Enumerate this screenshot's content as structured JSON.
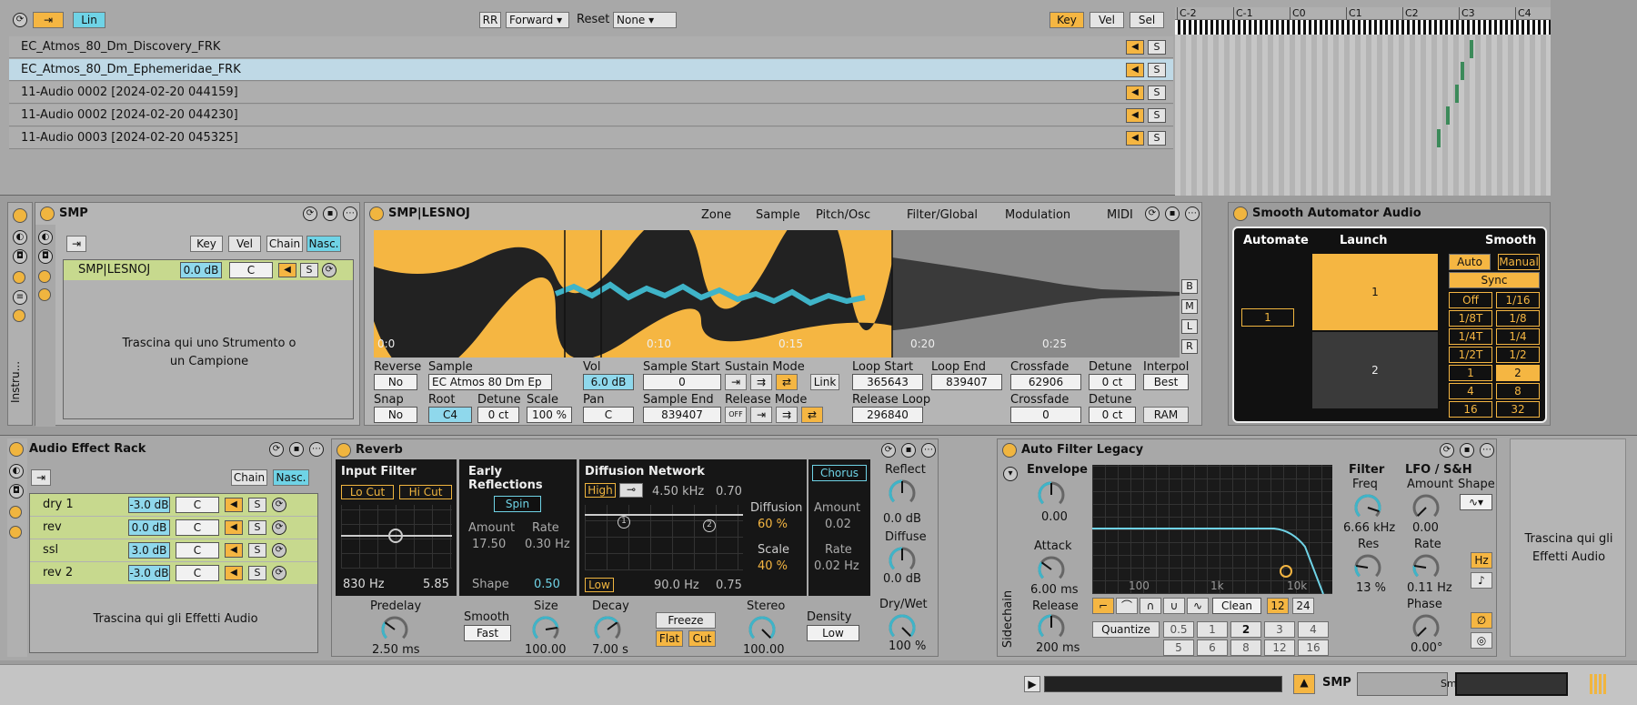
{
  "topbar": {
    "lin": "Lin",
    "rr": "RR",
    "forward": "Forward",
    "reset": "Reset",
    "reset_val": "None",
    "key": "Key",
    "vel": "Vel",
    "sel": "Sel"
  },
  "keyboard": {
    "notes": [
      "C-2",
      "C-1",
      "C0",
      "C1",
      "C2",
      "C3",
      "C4"
    ]
  },
  "samples": [
    {
      "name": "EC_Atmos_80_Dm_Discovery_FRK"
    },
    {
      "name": "EC_Atmos_80_Dm_Ephemeridae_FRK"
    },
    {
      "name": "11-Audio 0002 [2024-02-20 044159]"
    },
    {
      "name": "11-Audio 0002 [2024-02-20 044230]"
    },
    {
      "name": "11-Audio 0003 [2024-02-20 045325]"
    }
  ],
  "solo_label": "S",
  "side": {
    "label": "Instru..."
  },
  "smp_rack": {
    "title": "SMP",
    "key": "Key",
    "vel": "Vel",
    "chain": "Chain",
    "nasc": "Nasc.",
    "chain_name": "SMP|LESNOJ",
    "vol": "0.0 dB",
    "pan": "C",
    "drop": "Trascina qui uno Strumento o un Campione"
  },
  "sampler": {
    "title": "SMP|LESNOJ",
    "tabs": [
      "Zone",
      "Sample",
      "Pitch/Osc",
      "Filter/Global",
      "Modulation",
      "MIDI"
    ],
    "time_labels": [
      "0:0",
      "0:10",
      "0:15",
      "0:20",
      "0:25"
    ],
    "side_btns": [
      "B",
      "M",
      "L",
      "R"
    ],
    "reverse_l": "Reverse",
    "reverse": "No",
    "sample_l": "Sample",
    "sample": "EC Atmos 80 Dm Ep",
    "vol_l": "Vol",
    "vol": "6.0 dB",
    "sstart_l": "Sample Start",
    "sstart": "0",
    "sus_l": "Sustain Mode",
    "link": "Link",
    "lstart_l": "Loop Start",
    "lstart": "365643",
    "lend_l": "Loop End",
    "lend": "839407",
    "xfade_l": "Crossfade",
    "xfade": "62906",
    "det_l": "Detune",
    "det": "0 ct",
    "interp_l": "Interpol",
    "interp": "Best",
    "snap_l": "Snap",
    "snap": "No",
    "root_l": "Root",
    "root": "C4",
    "det2_l": "Detune",
    "det2": "0 ct",
    "scale_l": "Scale",
    "scale": "100 %",
    "pan_l": "Pan",
    "pan": "C",
    "send_l": "Sample End",
    "send": "839407",
    "rel_l": "Release Mode",
    "off": "OFF",
    "rloop_l": "Release Loop",
    "rloop": "296840",
    "xfade2_l": "Crossfade",
    "xfade2": "0",
    "det3_l": "Detune",
    "det3": "0 ct",
    "ram": "RAM"
  },
  "automator": {
    "title": "Smooth Automator Audio",
    "automate": "Automate",
    "launch": "Launch",
    "smooth": "Smooth",
    "auto": "Auto",
    "manual": "Manual",
    "sync": "Sync",
    "value": "1",
    "slot1": "1",
    "slot2": "2",
    "grid": [
      "Off",
      "1/16",
      "1/8T",
      "1/8",
      "1/4T",
      "1/4",
      "1/2T",
      "1/2",
      "1",
      "2",
      "4",
      "8",
      "16",
      "32"
    ]
  },
  "fx_rack": {
    "title": "Audio Effect Rack",
    "chain": "Chain",
    "nasc": "Nasc.",
    "chains": [
      {
        "name": "dry 1",
        "vol": "-3.0 dB",
        "pan": "C"
      },
      {
        "name": "rev",
        "vol": "0.0 dB",
        "pan": "C"
      },
      {
        "name": "ssl",
        "vol": "3.0 dB",
        "pan": "C"
      },
      {
        "name": "rev 2",
        "vol": "-3.0 dB",
        "pan": "C"
      }
    ],
    "drop": "Trascina qui gli Effetti Audio"
  },
  "reverb": {
    "title": "Reverb",
    "input": "Input Filter",
    "locut": "Lo Cut",
    "hicut": "Hi Cut",
    "freq": "830 Hz",
    "width": "5.85",
    "early": "Early Reflections",
    "spin": "Spin",
    "amount_l": "Amount",
    "rate_l": "Rate",
    "amount": "17.50",
    "rate": "0.30 Hz",
    "shape_l": "Shape",
    "shape": "0.50",
    "diff": "Diffusion Network",
    "high": "High",
    "hfreq": "4.50 kHz",
    "hval": "0.70",
    "diffusion_l": "Diffusion",
    "diffusion": "60 %",
    "scale_l": "Scale",
    "scale": "40 %",
    "low": "Low",
    "lfreq": "90.0 Hz",
    "lval": "0.75",
    "chorus": "Chorus",
    "camount_l": "Amount",
    "camount": "0.02",
    "crate_l": "Rate",
    "crate": "0.02 Hz",
    "reflect_l": "Reflect",
    "reflect": "0.0 dB",
    "diffuse_l": "Diffuse",
    "diffuse": "0.0 dB",
    "drywet_l": "Dry/Wet",
    "drywet": "100 %",
    "predelay_l": "Predelay",
    "predelay": "2.50 ms",
    "smooth_l": "Smooth",
    "smooth": "Fast",
    "size_l": "Size",
    "size": "100.00",
    "decay_l": "Decay",
    "decay": "7.00 s",
    "freeze": "Freeze",
    "flat": "Flat",
    "cut": "Cut",
    "stereo_l": "Stereo",
    "stereo": "100.00",
    "density_l": "Density",
    "density": "Low"
  },
  "autofilter": {
    "title": "Auto Filter Legacy",
    "sidechain": "Sidechain",
    "env": "Envelope",
    "env_val": "0.00",
    "attack_l": "Attack",
    "attack": "6.00 ms",
    "release_l": "Release",
    "release": "200 ms",
    "fticks": [
      "100",
      "1k",
      "10k"
    ],
    "mode": "Clean",
    "p12": "12",
    "p24": "24",
    "quantize": "Quantize",
    "q": [
      "0.5",
      "1",
      "2",
      "3",
      "4",
      "5",
      "6",
      "8",
      "12",
      "16"
    ],
    "filter_l": "Filter",
    "freq_l": "Freq",
    "freq": "6.66 kHz",
    "res_l": "Res",
    "res": "13 %",
    "lfo": "LFO / S&H",
    "lamount_l": "Amount",
    "lamount": "0.00",
    "shape_l": "Shape",
    "lrate_l": "Rate",
    "lrate": "0.11 Hz",
    "hz": "Hz",
    "phase_l": "Phase",
    "phase": "0.00°"
  },
  "drop_fx": "Trascina qui gli Effetti Audio",
  "status": {
    "smp": "SMP",
    "smoo": "Smoo"
  }
}
